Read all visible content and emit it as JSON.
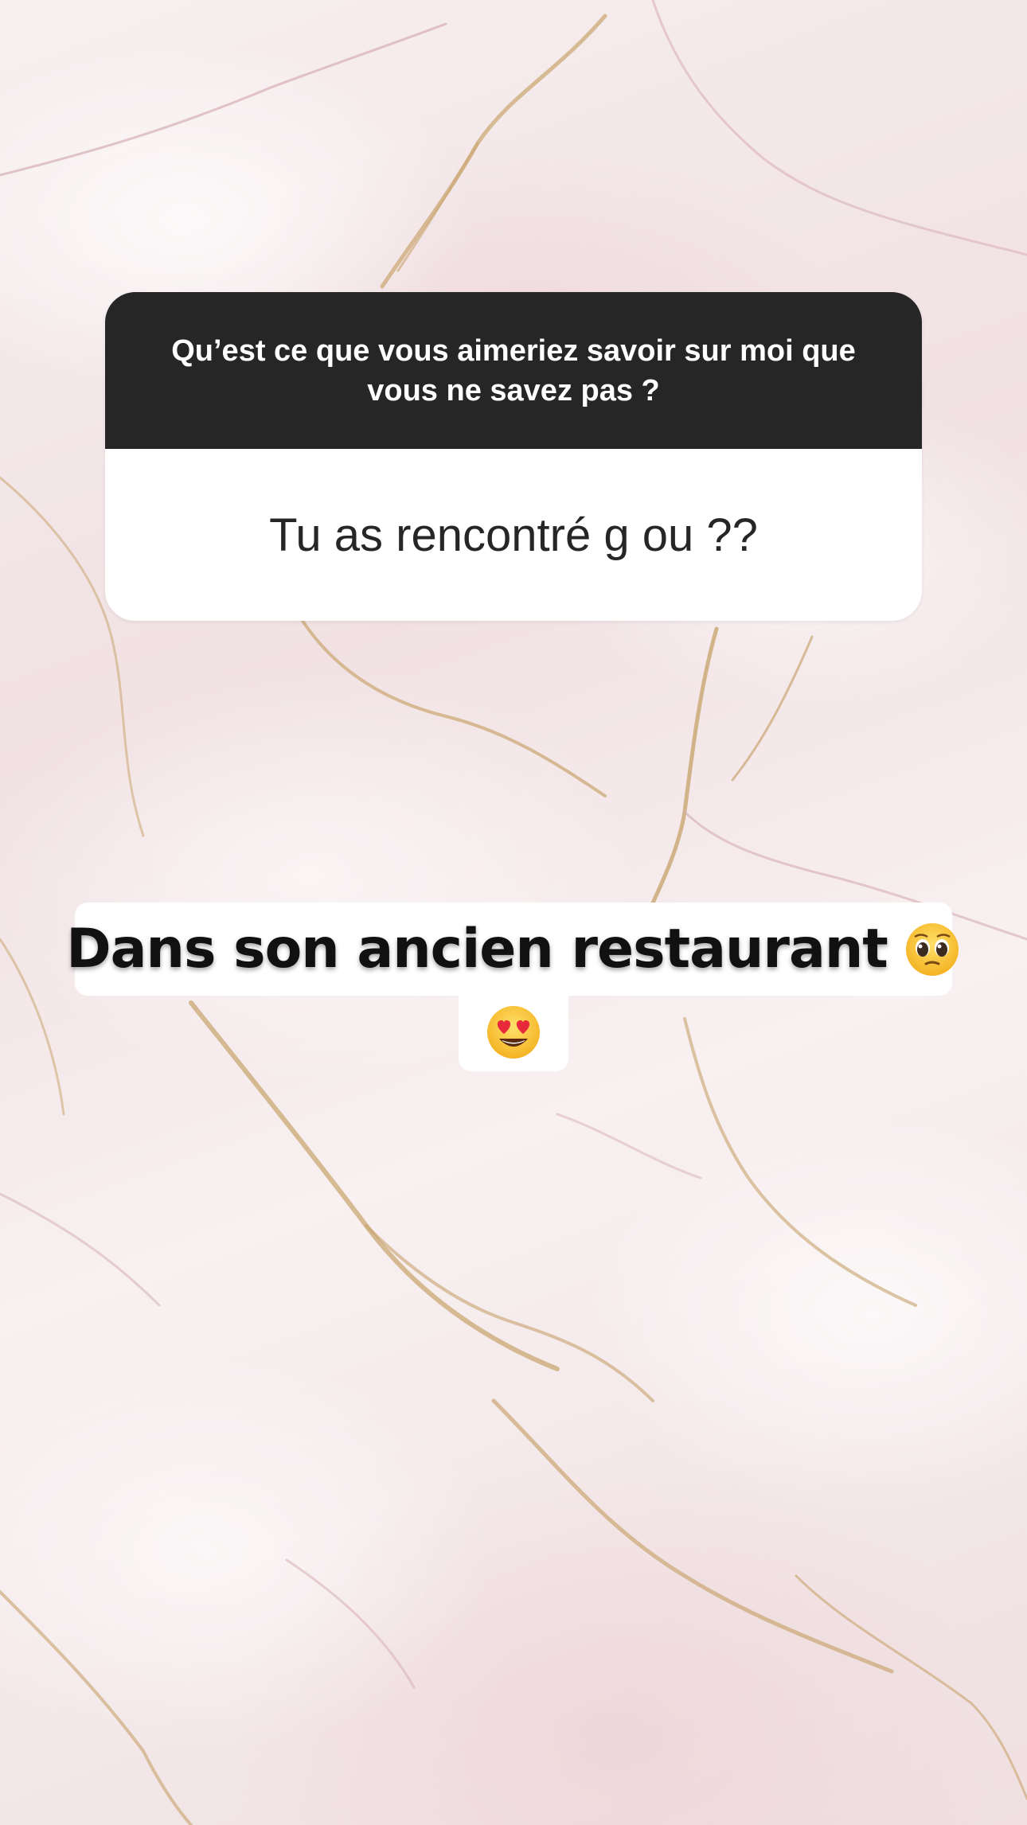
{
  "question_sticker": {
    "question": "Qu’est ce que vous aimeriez savoir sur moi que vous ne savez pas ?",
    "answer": "Tu as rencontré g ou ??"
  },
  "reply_caption": {
    "text": "Dans son ancien restaurant",
    "emojis": [
      "pleading-face-emoji",
      "heart-eyes-emoji"
    ]
  },
  "colors": {
    "question_header_bg": "#262626",
    "card_bg": "#ffffff",
    "text_dark": "#262626"
  }
}
